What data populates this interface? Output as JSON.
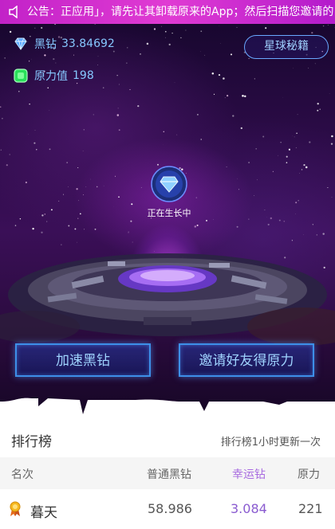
{
  "notice": {
    "icon": "speaker-icon",
    "text": "公告：正应用」，请先让其卸载原来的App；然后扫描您邀请的"
  },
  "stats": {
    "diamond": {
      "icon": "diamond-icon",
      "label": "黑钻",
      "value": "33.84692"
    },
    "power": {
      "icon": "green-gem-icon",
      "label": "原力值",
      "value": "198"
    }
  },
  "secret_button": "星球秘籍",
  "grow": {
    "icon": "diamond-orb-icon",
    "label": "正在生长中"
  },
  "actions": {
    "speed": "加速黑钻",
    "invite": "邀请好友得原力"
  },
  "ranking": {
    "title": "排行榜",
    "note": "排行榜1小时更新一次",
    "columns": {
      "rank": "名次",
      "normal": "普通黑钻",
      "lucky": "幸运钻",
      "power": "原力"
    },
    "rows": [
      {
        "name": "暮天",
        "normal": "58.986",
        "lucky": "3.084",
        "power": "221",
        "medal_icon": "gold-medal-icon"
      }
    ]
  },
  "colors": {
    "notice_bg": "#d02fce",
    "accent_blue": "#3d8fe8",
    "lucky_purple": "#8a5bd0"
  }
}
